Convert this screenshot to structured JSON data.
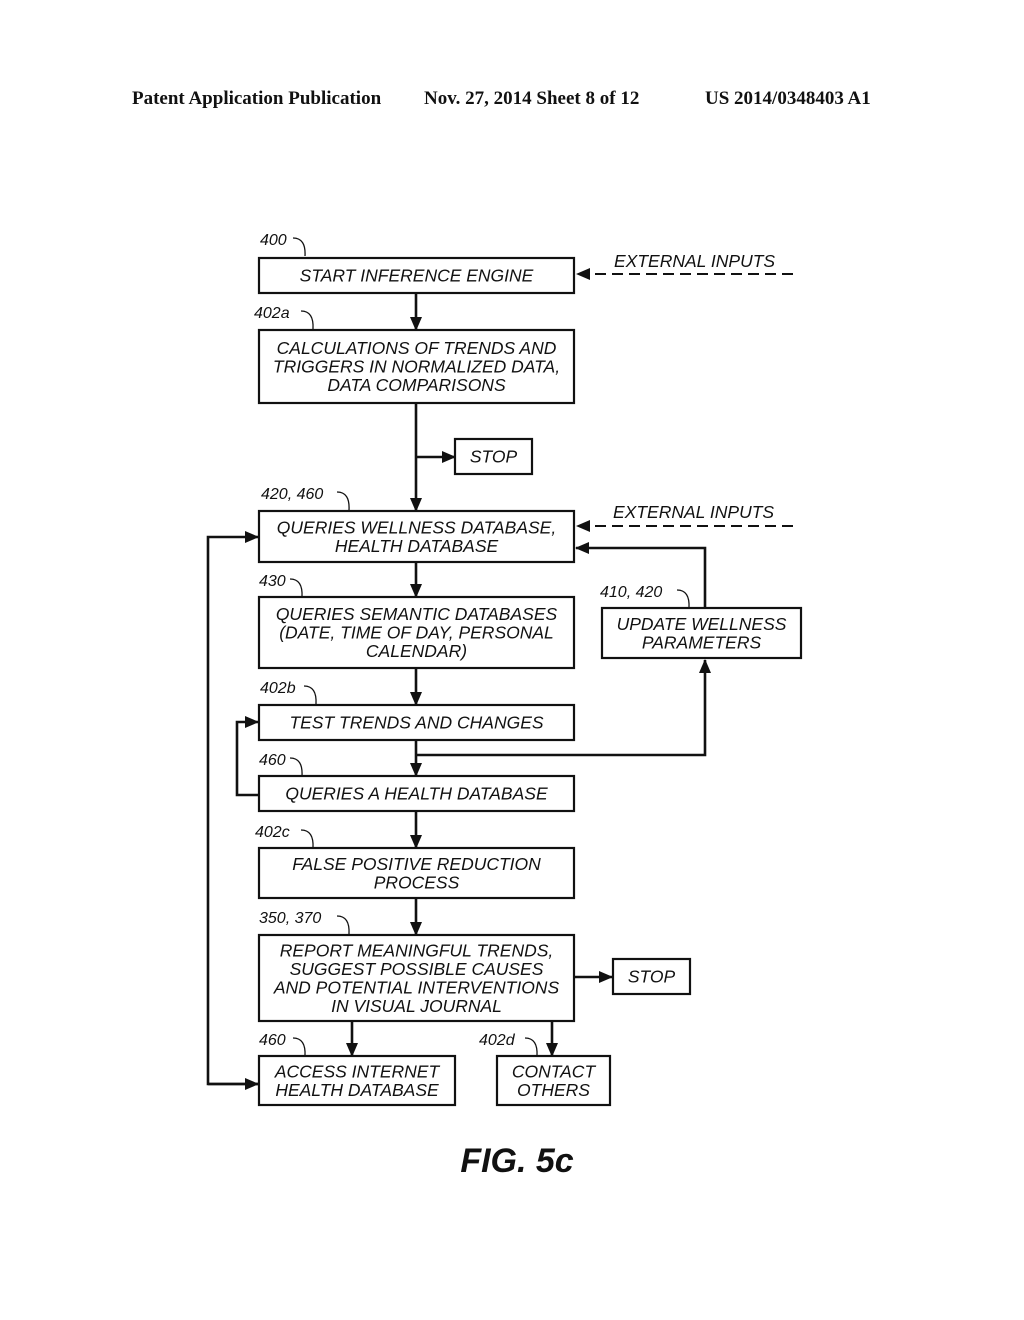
{
  "header": {
    "left": "Patent Application Publication",
    "middle": "Nov. 27, 2014   Sheet 8 of 12",
    "right": "US 2014/0348403 A1"
  },
  "figure_label": "FIG. 5c",
  "external_inputs_label": "EXTERNAL INPUTS",
  "nodes": {
    "start": {
      "ref": "400",
      "lines": [
        "START INFERENCE ENGINE"
      ]
    },
    "calc": {
      "ref": "402a",
      "lines": [
        "CALCULATIONS OF TRENDS AND",
        "TRIGGERS IN NORMALIZED DATA,",
        "DATA COMPARISONS"
      ]
    },
    "stop1": {
      "lines": [
        "STOP"
      ]
    },
    "wellness_query": {
      "ref": "420, 460",
      "lines": [
        "QUERIES WELLNESS DATABASE,",
        "HEALTH DATABASE"
      ]
    },
    "semantic_query": {
      "ref": "430",
      "lines": [
        "QUERIES SEMANTIC DATABASES",
        "(DATE, TIME OF DAY, PERSONAL",
        "CALENDAR)"
      ]
    },
    "update_params": {
      "ref": "410, 420",
      "lines": [
        "UPDATE WELLNESS",
        "PARAMETERS"
      ]
    },
    "test_trends": {
      "ref": "402b",
      "lines": [
        "TEST TRENDS AND CHANGES"
      ]
    },
    "health_query": {
      "ref": "460",
      "lines": [
        "QUERIES A HEALTH DATABASE"
      ]
    },
    "false_positive": {
      "ref": "402c",
      "lines": [
        "FALSE POSITIVE REDUCTION",
        "PROCESS"
      ]
    },
    "report": {
      "ref": "350, 370",
      "lines": [
        "REPORT MEANINGFUL TRENDS,",
        "SUGGEST POSSIBLE CAUSES",
        "AND POTENTIAL INTERVENTIONS",
        "IN VISUAL JOURNAL"
      ]
    },
    "stop2": {
      "lines": [
        "STOP"
      ]
    },
    "internet_db": {
      "ref": "460",
      "lines": [
        "ACCESS INTERNET",
        "HEALTH DATABASE"
      ]
    },
    "contact": {
      "ref": "402d",
      "lines": [
        "CONTACT",
        "OTHERS"
      ]
    }
  }
}
